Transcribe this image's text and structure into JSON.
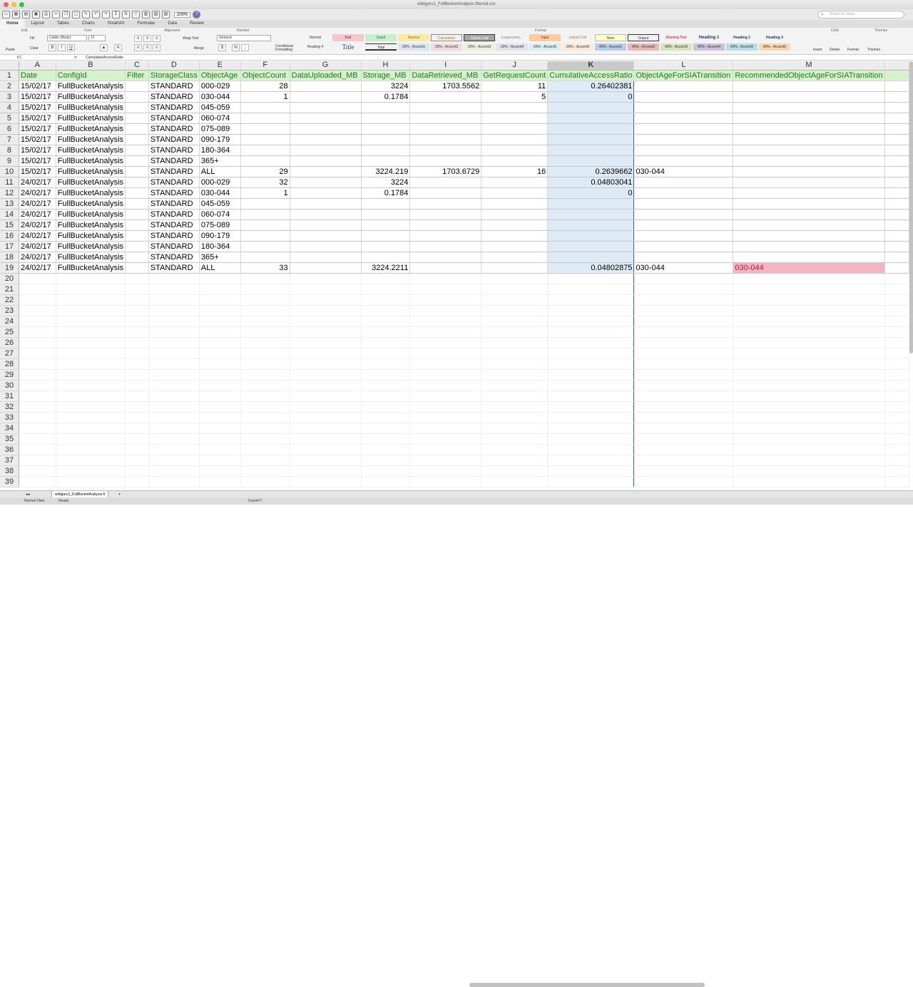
{
  "window": {
    "title": "wildguru1_FullBucketAnalysis.filtered.csv",
    "zoom": "200%"
  },
  "search": {
    "placeholder": "Search in Sheet"
  },
  "ribbon_tabs": [
    "Home",
    "Layout",
    "Tables",
    "Charts",
    "SmartArt",
    "Formulas",
    "Data",
    "Review"
  ],
  "ribbon": {
    "groups": {
      "edit": "Edit",
      "font": "Font",
      "alignment": "Alignment",
      "number": "Number",
      "format": "Format",
      "cells": "Cells",
      "themes": "Themes"
    },
    "paste": "Paste",
    "fill": "Fill",
    "clear": "Clear",
    "font_name": "Calibri (Body)",
    "font_size": "12",
    "wrap_text": "Wrap Text",
    "merge": "Merge",
    "number_format": "General",
    "conditional_formatting": "Conditional Formatting",
    "styles_row1": [
      "Normal",
      "Bad",
      "Good",
      "Neutral",
      "Calculation",
      "Check Cell",
      "Explanatory...",
      "Input",
      "Linked Cell",
      "Note",
      "Output",
      "Warning Text",
      "Heading 1",
      "Heading 2",
      "Heading 3"
    ],
    "styles_row2": [
      "Heading 4",
      "Title",
      "Total",
      "20% - Accent1",
      "20% - Accent2",
      "20% - Accent3",
      "20% - Accent4",
      "20% - Accent5",
      "20% - Accent6",
      "40% - Accent1",
      "40% - Accent2",
      "40% - Accent3",
      "40% - Accent4",
      "40% - Accent5",
      "40% - Accent6"
    ],
    "insert": "Insert",
    "delete": "Delete",
    "format_btn": "Format",
    "themes_btn": "Themes"
  },
  "formula_bar": {
    "name_box": "K1",
    "fx": "fx",
    "content": "CumulativeAccessRatio"
  },
  "columns": [
    "A",
    "B",
    "C",
    "D",
    "E",
    "F",
    "G",
    "H",
    "I",
    "J",
    "K",
    "L",
    "M"
  ],
  "header_row": [
    "Date",
    "ConfigId",
    "Filter",
    "StorageClass",
    "ObjectAge",
    "ObjectCount",
    "DataUploaded_MB",
    "Storage_MB",
    "DataRetrieved_MB",
    "GetRequestCount",
    "CumulativeAccessRatio",
    "ObjectAgeForSIATransition",
    "RecommendedObjectAgeForSIATransition"
  ],
  "rows": [
    [
      "15/02/17",
      "FullBucketAnalysis",
      "",
      "STANDARD",
      "000-029",
      "28",
      "",
      "3224",
      "1703.5562",
      "11",
      "0.26402381",
      "",
      ""
    ],
    [
      "15/02/17",
      "FullBucketAnalysis",
      "",
      "STANDARD",
      "030-044",
      "1",
      "",
      "0.1784",
      "",
      "5",
      "0",
      "",
      ""
    ],
    [
      "15/02/17",
      "FullBucketAnalysis",
      "",
      "STANDARD",
      "045-059",
      "",
      "",
      "",
      "",
      "",
      "",
      "",
      ""
    ],
    [
      "15/02/17",
      "FullBucketAnalysis",
      "",
      "STANDARD",
      "060-074",
      "",
      "",
      "",
      "",
      "",
      "",
      "",
      ""
    ],
    [
      "15/02/17",
      "FullBucketAnalysis",
      "",
      "STANDARD",
      "075-089",
      "",
      "",
      "",
      "",
      "",
      "",
      "",
      ""
    ],
    [
      "15/02/17",
      "FullBucketAnalysis",
      "",
      "STANDARD",
      "090-179",
      "",
      "",
      "",
      "",
      "",
      "",
      "",
      ""
    ],
    [
      "15/02/17",
      "FullBucketAnalysis",
      "",
      "STANDARD",
      "180-364",
      "",
      "",
      "",
      "",
      "",
      "",
      "",
      ""
    ],
    [
      "15/02/17",
      "FullBucketAnalysis",
      "",
      "STANDARD",
      "365+",
      "",
      "",
      "",
      "",
      "",
      "",
      "",
      ""
    ],
    [
      "15/02/17",
      "FullBucketAnalysis",
      "",
      "STANDARD",
      "ALL",
      "29",
      "",
      "3224.219",
      "1703.6729",
      "16",
      "0.2639662",
      "030-044",
      ""
    ],
    [
      "24/02/17",
      "FullBucketAnalysis",
      "",
      "STANDARD",
      "000-029",
      "32",
      "",
      "3224",
      "",
      "",
      "0.04803041",
      "",
      ""
    ],
    [
      "24/02/17",
      "FullBucketAnalysis",
      "",
      "STANDARD",
      "030-044",
      "1",
      "",
      "0.1784",
      "",
      "",
      "0",
      "",
      ""
    ],
    [
      "24/02/17",
      "FullBucketAnalysis",
      "",
      "STANDARD",
      "045-059",
      "",
      "",
      "",
      "",
      "",
      "",
      "",
      ""
    ],
    [
      "24/02/17",
      "FullBucketAnalysis",
      "",
      "STANDARD",
      "060-074",
      "",
      "",
      "",
      "",
      "",
      "",
      "",
      ""
    ],
    [
      "24/02/17",
      "FullBucketAnalysis",
      "",
      "STANDARD",
      "075-089",
      "",
      "",
      "",
      "",
      "",
      "",
      "",
      ""
    ],
    [
      "24/02/17",
      "FullBucketAnalysis",
      "",
      "STANDARD",
      "090-179",
      "",
      "",
      "",
      "",
      "",
      "",
      "",
      ""
    ],
    [
      "24/02/17",
      "FullBucketAnalysis",
      "",
      "STANDARD",
      "180-364",
      "",
      "",
      "",
      "",
      "",
      "",
      "",
      ""
    ],
    [
      "24/02/17",
      "FullBucketAnalysis",
      "",
      "STANDARD",
      "365+",
      "",
      "",
      "",
      "",
      "",
      "",
      "",
      ""
    ],
    [
      "24/02/17",
      "FullBucketAnalysis",
      "",
      "STANDARD",
      "ALL",
      "33",
      "",
      "3224.2211",
      "",
      "",
      "0.04802875",
      "030-044",
      "030-044"
    ]
  ],
  "total_rows_visible": 39,
  "selected_column": "K",
  "highlight_color": "#f3b6c1",
  "sheet_tab": "wildguru1_FullBucketAnalysis.fi",
  "status": {
    "view": "Normal View",
    "ready": "Ready",
    "count": "Count=7"
  }
}
